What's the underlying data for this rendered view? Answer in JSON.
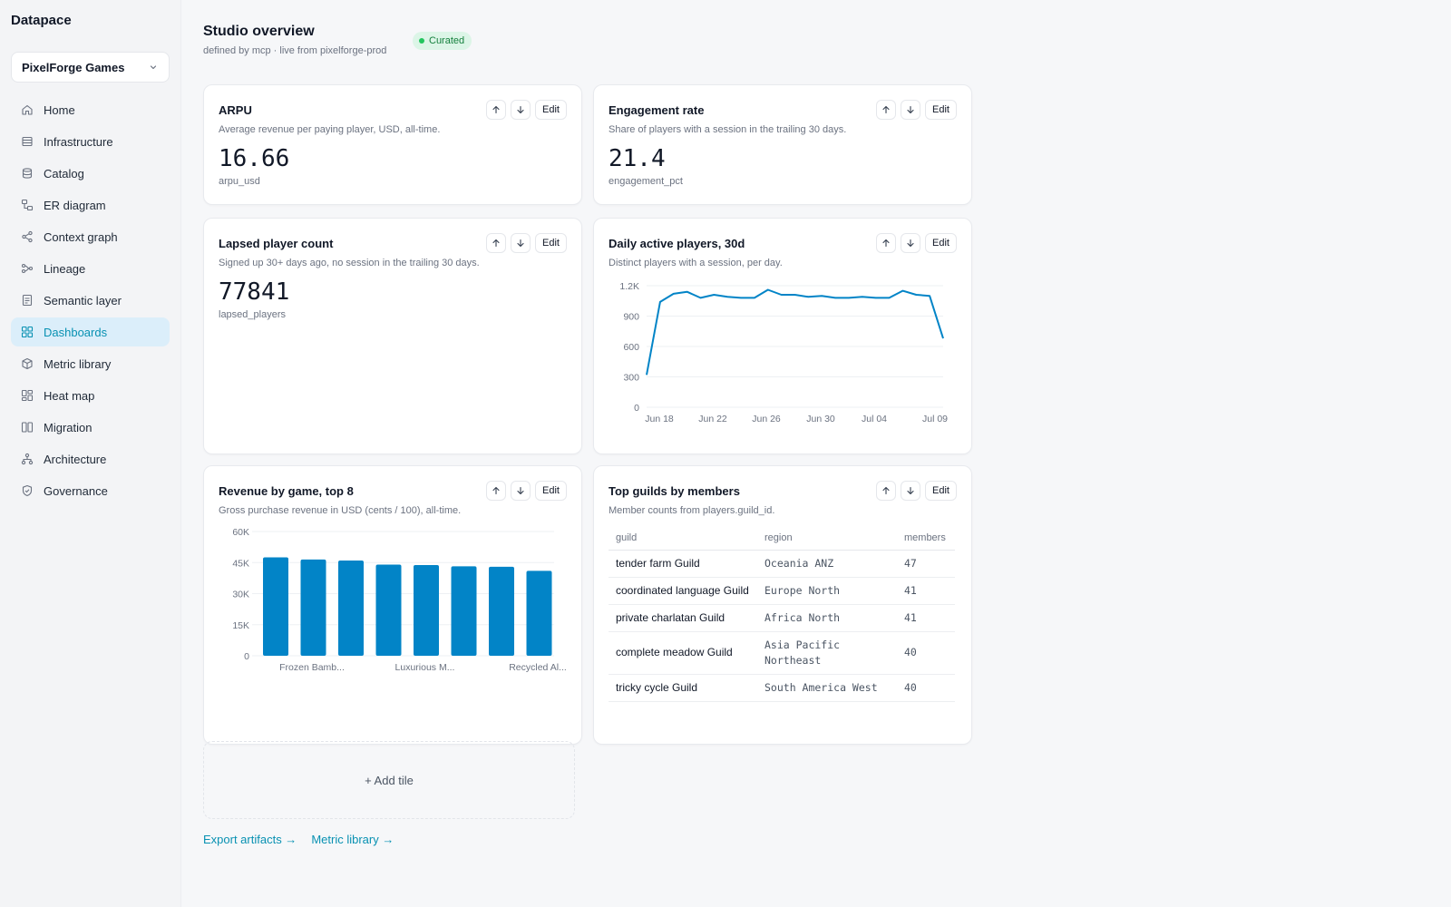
{
  "app": {
    "name": "Datapace"
  },
  "org_selector": {
    "value": "PixelForge Games",
    "icon": "chevron-down-icon"
  },
  "nav": {
    "items": [
      {
        "label": "Home",
        "icon": "home-icon"
      },
      {
        "label": "Infrastructure",
        "icon": "server-icon"
      },
      {
        "label": "Catalog",
        "icon": "database-icon"
      },
      {
        "label": "ER diagram",
        "icon": "er-diagram-icon"
      },
      {
        "label": "Context graph",
        "icon": "share-icon"
      },
      {
        "label": "Lineage",
        "icon": "lineage-icon"
      },
      {
        "label": "Semantic layer",
        "icon": "document-icon"
      },
      {
        "label": "Dashboards",
        "icon": "grid-icon",
        "active": true
      },
      {
        "label": "Metric library",
        "icon": "cube-icon"
      },
      {
        "label": "Heat map",
        "icon": "heatmap-icon"
      },
      {
        "label": "Migration",
        "icon": "columns-icon"
      },
      {
        "label": "Architecture",
        "icon": "hierarchy-icon"
      },
      {
        "label": "Governance",
        "icon": "shield-icon"
      }
    ]
  },
  "page": {
    "title": "Studio overview",
    "subtitle": "defined by mcp · live from pixelforge-prod",
    "badge": "Curated",
    "badge_color": "#22c55e"
  },
  "actions": {
    "edit_label": "Edit",
    "up_icon": "arrow-up-icon",
    "down_icon": "arrow-down-icon"
  },
  "tiles": {
    "arpu": {
      "title": "ARPU",
      "description": "Average revenue per paying player, USD, all-time.",
      "value": "16.66",
      "field": "arpu_usd"
    },
    "engagement": {
      "title": "Engagement rate",
      "description": "Share of players with a session in the trailing 30 days.",
      "value": "21.4",
      "field": "engagement_pct"
    },
    "lapsed": {
      "title": "Lapsed player count",
      "description": "Signed up 30+ days ago, no session in the trailing 30 days.",
      "value": "77841",
      "field": "lapsed_players"
    },
    "dap": {
      "title": "Daily active players, 30d",
      "description": "Distinct players with a session, per day."
    },
    "revenue": {
      "title": "Revenue by game, top 8",
      "description": "Gross purchase revenue in USD (cents / 100), all-time."
    },
    "guilds": {
      "title": "Top guilds by members",
      "description": "Member counts from players.guild_id.",
      "columns": [
        "guild",
        "region",
        "members"
      ],
      "rows": [
        {
          "guild": "tender farm Guild",
          "region": "Oceania ANZ",
          "members": "47"
        },
        {
          "guild": "coordinated language Guild",
          "region": "Europe North",
          "members": "41"
        },
        {
          "guild": "private charlatan Guild",
          "region": "Africa North",
          "members": "41"
        },
        {
          "guild": "complete meadow Guild",
          "region": "Asia Pacific Northeast",
          "members": "40"
        },
        {
          "guild": "tricky cycle Guild",
          "region": "South America West",
          "members": "40"
        }
      ]
    }
  },
  "add_tile": {
    "label": "+ Add tile"
  },
  "footer": {
    "export_label": "Export artifacts →",
    "metric_library_label": "Metric library →"
  },
  "colors": {
    "accent": "#0891b2",
    "chart": "#0284c7"
  },
  "chart_data": [
    {
      "type": "line",
      "x": [
        "Jun 18",
        "Jun 19",
        "Jun 20",
        "Jun 21",
        "Jun 22",
        "Jun 23",
        "Jun 24",
        "Jun 25",
        "Jun 26",
        "Jun 27",
        "Jun 28",
        "Jun 29",
        "Jun 30",
        "Jul 01",
        "Jul 02",
        "Jul 03",
        "Jul 04",
        "Jul 05",
        "Jul 06",
        "Jul 07",
        "Jul 08",
        "Jul 09"
      ],
      "series": [
        {
          "values": [
            320,
            1040,
            1120,
            1140,
            1080,
            1110,
            1090,
            1080,
            1080,
            1160,
            1110,
            1110,
            1090,
            1100,
            1080,
            1080,
            1090,
            1080,
            1080,
            1150,
            1110,
            1100,
            680
          ]
        }
      ],
      "x_tick_labels": [
        "Jun 18",
        "Jun 22",
        "Jun 26",
        "Jun 30",
        "Jul 04",
        "Jul 09"
      ],
      "y_tick_labels": [
        "0",
        "300",
        "600",
        "900",
        "1.2K"
      ],
      "ylim": [
        0,
        1200
      ],
      "grid": true
    },
    {
      "type": "bar",
      "categories": [
        "Frozen Bamb...",
        "",
        "",
        "Luxurious M...",
        "",
        "",
        "Recycled Al...",
        ""
      ],
      "x_tick_labels": [
        "Frozen Bamb...",
        "Luxurious M...",
        "Recycled Al..."
      ],
      "values": [
        47500,
        46500,
        46000,
        44000,
        43800,
        43200,
        43000,
        41000
      ],
      "y_tick_labels": [
        "0",
        "15K",
        "30K",
        "45K",
        "60K"
      ],
      "ylim": [
        0,
        60000
      ],
      "grid": true
    }
  ]
}
